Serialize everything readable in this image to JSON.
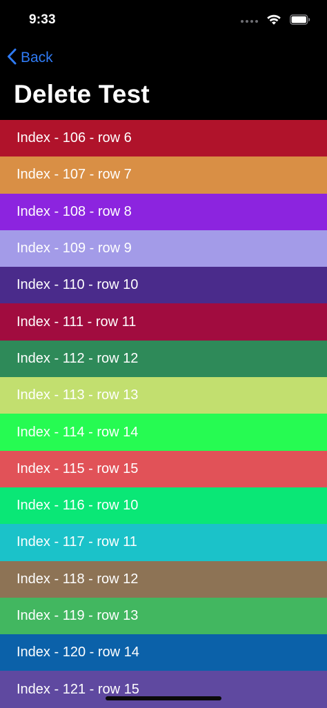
{
  "status_bar": {
    "time": "9:33",
    "icons": [
      "cellular-dots-icon",
      "wifi-icon",
      "battery-icon"
    ]
  },
  "nav": {
    "back_label": "Back",
    "back_icon": "chevron-left-icon",
    "title": "Delete Test",
    "accent_color": "#2f7bf5"
  },
  "rows": [
    {
      "label": "Index - 106 - row 6",
      "color": "#b0132b"
    },
    {
      "label": "Index - 107 - row 7",
      "color": "#d98f45"
    },
    {
      "label": "Index - 108 - row 8",
      "color": "#8c24df"
    },
    {
      "label": "Index - 109 - row 9",
      "color": "#a39be8"
    },
    {
      "label": "Index - 110 - row 10",
      "color": "#4a2b8b"
    },
    {
      "label": "Index - 111 - row 11",
      "color": "#a10c3f"
    },
    {
      "label": "Index - 112 - row 12",
      "color": "#2e8a59"
    },
    {
      "label": "Index - 113 - row 13",
      "color": "#c2df6f"
    },
    {
      "label": "Index - 114 - row 14",
      "color": "#26fb52"
    },
    {
      "label": "Index - 115 - row 15",
      "color": "#e15258"
    },
    {
      "label": "Index - 116 - row 10",
      "color": "#0ae776"
    },
    {
      "label": "Index - 117 - row 11",
      "color": "#1bc2c9"
    },
    {
      "label": "Index - 118 - row 12",
      "color": "#8d7355"
    },
    {
      "label": "Index - 119 - row 13",
      "color": "#42b760"
    },
    {
      "label": "Index - 120 - row 14",
      "color": "#0b61a9"
    },
    {
      "label": "Index - 121 - row 15",
      "color": "#5f49a0"
    }
  ]
}
